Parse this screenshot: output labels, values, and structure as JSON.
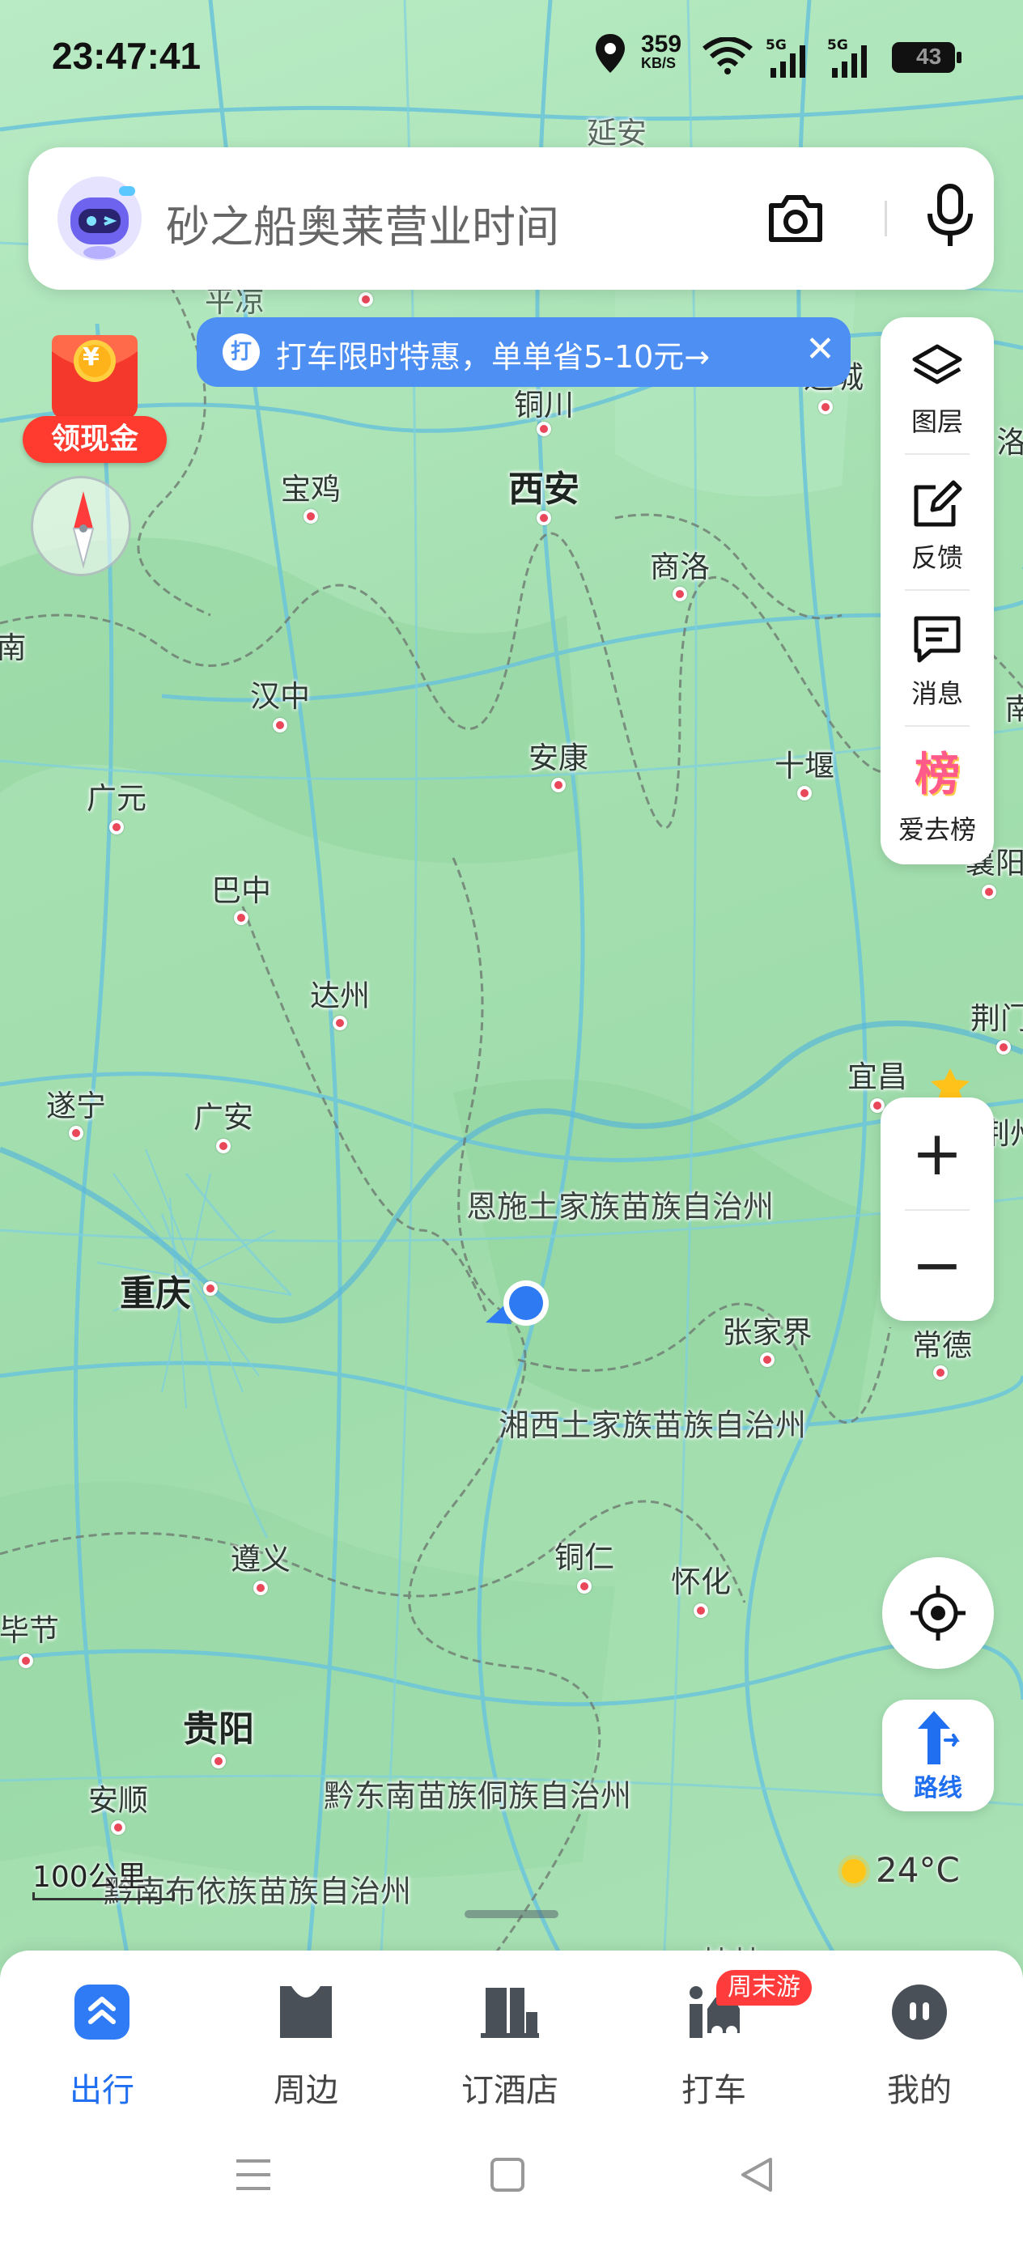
{
  "status_bar": {
    "time": "23:47:41",
    "net_speed_value": "359",
    "net_speed_unit": "KB/S",
    "sim1": "5G",
    "sim2": "5G",
    "battery": "43"
  },
  "search": {
    "placeholder": "砂之船奥莱营业时间"
  },
  "banner": {
    "icon_text": "打",
    "text": "打车限时特惠，单单省5-10元→",
    "close": "✕"
  },
  "hongbao": {
    "label": "领现金",
    "symbol": "¥"
  },
  "right_panel": [
    {
      "label": "图层",
      "icon": "layers-icon"
    },
    {
      "label": "反馈",
      "icon": "feedback-icon"
    },
    {
      "label": "消息",
      "icon": "message-icon"
    },
    {
      "label": "爱去榜",
      "icon": "ranking-icon",
      "glyph": "榜"
    }
  ],
  "zoom": {
    "plus": "+",
    "minus": "−"
  },
  "route": {
    "label": "路线"
  },
  "scale": {
    "label": "100公里"
  },
  "weather": {
    "temp": "24°C"
  },
  "map_labels": {
    "top_edge": "延安",
    "xian": "西安",
    "tongchuan": "铜川",
    "baoji": "宝鸡",
    "shangluo": "商洛",
    "hanzhong": "汉中",
    "ankang": "安康",
    "shiyan": "十堰",
    "guangyuan": "广元",
    "bazhong": "巴中",
    "dazhou": "达州",
    "suining": "遂宁",
    "guangan": "广安",
    "chongqing": "重庆",
    "yichang": "宜昌",
    "enshi": "恩施土家族苗族自治州",
    "zhangjiajie": "张家界",
    "changde": "常德",
    "xiangxi": "湘西土家族苗族自治州",
    "tongren": "铜仁",
    "huaihua": "怀化",
    "zunyi": "遵义",
    "guiyang": "贵阳",
    "anshun": "安顺",
    "qiandongnan": "黔东南苗族侗族自治州",
    "qiannan": "黔南布依族苗族自治州",
    "bijie_partial": "毕节",
    "pingliang_partial": "平凉",
    "yuncheng_partial": "运城",
    "luoyang_partial": "洛",
    "xiangyang_partial": "襄阳",
    "jingmen_partial": "荆门",
    "jingzhou_partial": "荆州",
    "left_partial": "南",
    "right_partial": "南",
    "bottom_partial": "桂林"
  },
  "bottom_nav": [
    {
      "label": "出行",
      "active": true,
      "icon": "travel-icon"
    },
    {
      "label": "周边",
      "active": false,
      "icon": "nearby-icon"
    },
    {
      "label": "订酒店",
      "active": false,
      "icon": "hotel-icon"
    },
    {
      "label": "打车",
      "active": false,
      "icon": "taxi-icon"
    },
    {
      "label": "我的",
      "active": false,
      "icon": "profile-icon"
    }
  ],
  "taxi_badge": "周末游",
  "colors": {
    "accent": "#1f6ff0",
    "banner": "#4d8ff2",
    "map_land": "#a5e0b1",
    "road": "#6ec6d8",
    "boundary": "#6e7a70",
    "red": "#ff3b2f"
  }
}
